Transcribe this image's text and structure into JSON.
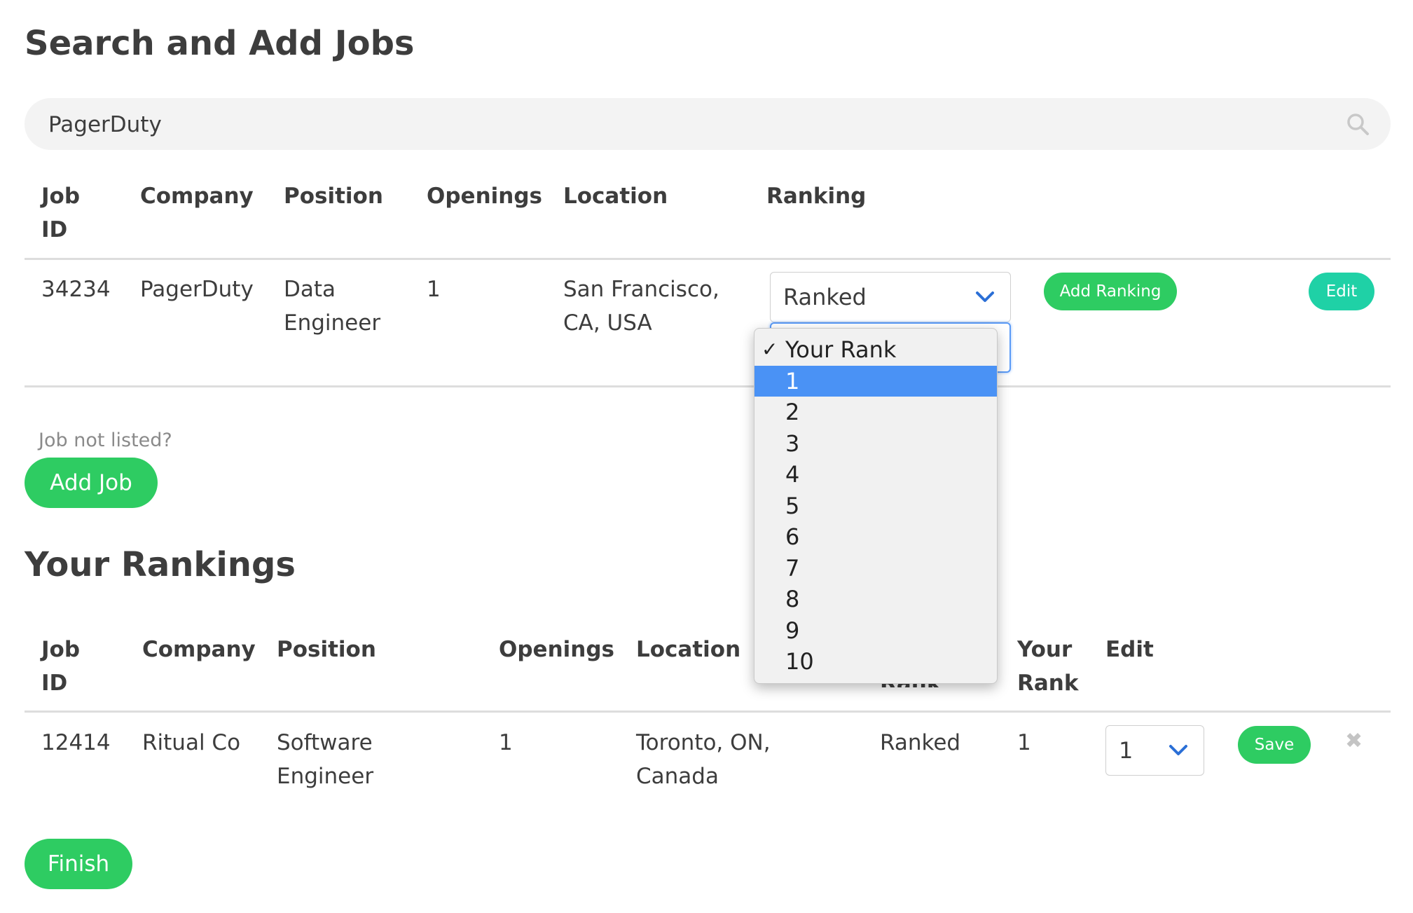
{
  "page_title": "Search and Add Jobs",
  "search": {
    "value": "PagerDuty",
    "placeholder": ""
  },
  "search_table": {
    "headers": {
      "job_id": "Job ID",
      "company": "Company",
      "position": "Position",
      "openings": "Openings",
      "location": "Location",
      "ranking": "Ranking"
    },
    "rows": [
      {
        "job_id": "34234",
        "company": "PagerDuty",
        "position": "Data Engineer",
        "openings": "1",
        "location": "San Francisco, CA, USA",
        "ranking_select": "Ranked",
        "add_ranking_label": "Add Ranking",
        "edit_label": "Edit"
      }
    ]
  },
  "rank_dropdown": {
    "checked_option": "Your Rank",
    "options": [
      "Your Rank",
      "1",
      "2",
      "3",
      "4",
      "5",
      "6",
      "7",
      "8",
      "9",
      "10"
    ],
    "highlighted": "1",
    "highlight_color": "#4a92f5"
  },
  "job_not_listed": "Job not listed?",
  "add_job_label": "Add Job",
  "rankings_title": "Your Rankings",
  "rankings_table": {
    "headers": {
      "job_id": "Job ID",
      "company": "Company",
      "position": "Position",
      "openings": "Openings",
      "location": "Location",
      "rank_partial": "Rank",
      "your_rank": "Your Rank",
      "edit": "Edit"
    },
    "rows": [
      {
        "job_id": "12414",
        "company": "Ritual Co",
        "position": "Software Engineer",
        "openings": "1",
        "location": "Toronto, ON, Canada",
        "status": "Ranked",
        "your_rank": "1",
        "rank_select": "1",
        "save_label": "Save",
        "remove_icon": "close-icon"
      }
    ]
  },
  "finish_label": "Finish",
  "colors": {
    "green": "#2ecc62",
    "teal": "#1fd1a6",
    "text": "#3d3d3d",
    "chevron": "#2b6fd6"
  }
}
